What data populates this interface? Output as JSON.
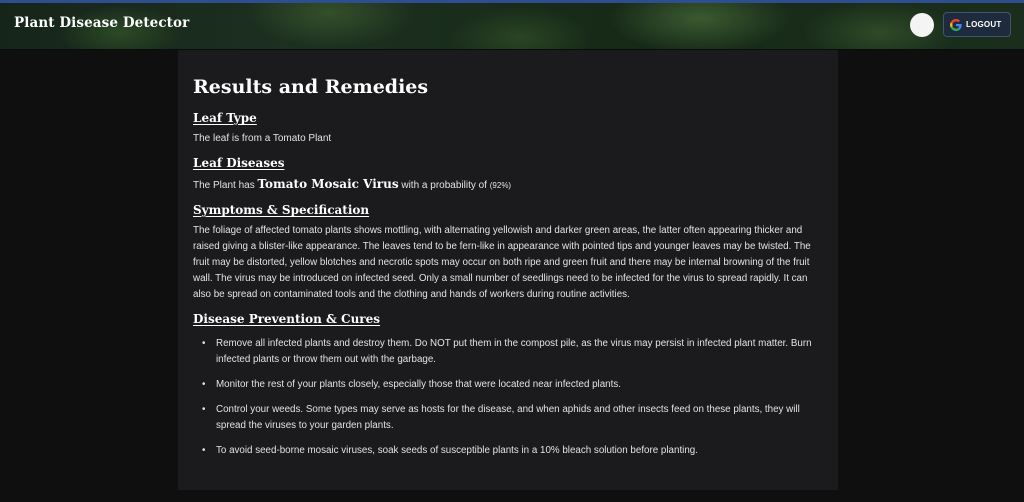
{
  "header": {
    "brand": "Plant Disease Detector",
    "logout_label": "LOGOUT",
    "logout_icon": "google-g-icon"
  },
  "main": {
    "title": "Results and Remedies",
    "leaf_type": {
      "heading": "Leaf Type",
      "text": "The leaf is from a Tomato Plant"
    },
    "leaf_diseases": {
      "heading": "Leaf Diseases",
      "prefix": "The Plant has",
      "disease": "Tomato Mosaic Virus",
      "middle": "with a probability of",
      "probability": "(92%)"
    },
    "symptoms": {
      "heading": "Symptoms & Specification",
      "text": "The foliage of affected tomato plants shows mottling, with alternating yellowish and darker green areas, the latter often appearing thicker and raised giving a blister-like appearance. The leaves tend to be fern-like in appearance with pointed tips and younger leaves may be twisted. The fruit may be distorted, yellow blotches and necrotic spots may occur on both ripe and green fruit and there may be internal browning of the fruit wall. The virus may be introduced on infected seed. Only a small number of seedlings need to be infected for the virus to spread rapidly. It can also be spread on contaminated tools and the clothing and hands of workers during routine activities."
    },
    "prevention": {
      "heading": "Disease Prevention & Cures",
      "items": [
        "Remove all infected plants and destroy them. Do NOT put them in the compost pile, as the virus may persist in infected plant matter. Burn infected plants or throw them out with the garbage.",
        "Monitor the rest of your plants closely, especially those that were located near infected plants.",
        "Control your weeds. Some types may serve as hosts for the disease, and when aphids and other insects feed on these plants, they will spread the viruses to your garden plants.",
        "To avoid seed-borne mosaic viruses, soak seeds of susceptible plants in a 10% bleach solution before planting."
      ]
    }
  }
}
